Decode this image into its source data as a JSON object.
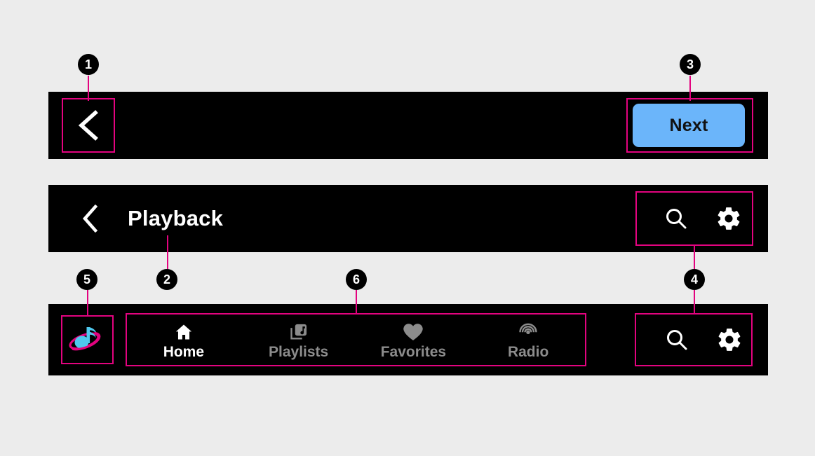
{
  "page": {
    "background_color": "#ececec",
    "surface_color": "#000000",
    "accent_color": "#6BB5FA",
    "annotation_color": "#E3037F",
    "active_text_color": "#ffffff",
    "inactive_text_color": "#8c8c8c"
  },
  "top_bar": {
    "back_icon": "chevron-left-icon",
    "next_label": "Next",
    "next_color": "#6BB5FA"
  },
  "nav_bar": {
    "back_icon": "chevron-left-icon",
    "title": "Playback",
    "actions": [
      {
        "icon": "search-icon",
        "name": "search-button"
      },
      {
        "icon": "gear-icon",
        "name": "settings-button"
      }
    ]
  },
  "tab_bar": {
    "logo_icon": "music-note-orbit-logo",
    "logo_note_color": "#4FC8EE",
    "logo_ring_color": "#E3037F",
    "tabs": [
      {
        "label": "Home",
        "icon": "home-icon",
        "active": true
      },
      {
        "label": "Playlists",
        "icon": "playlists-icon",
        "active": false
      },
      {
        "label": "Favorites",
        "icon": "heart-icon",
        "active": false
      },
      {
        "label": "Radio",
        "icon": "radio-broadcast-icon",
        "active": false
      }
    ],
    "actions": [
      {
        "icon": "search-icon",
        "name": "search-button"
      },
      {
        "icon": "gear-icon",
        "name": "settings-button"
      }
    ]
  },
  "callouts": [
    {
      "number": "1"
    },
    {
      "number": "2"
    },
    {
      "number": "3"
    },
    {
      "number": "4"
    },
    {
      "number": "5"
    },
    {
      "number": "6"
    }
  ]
}
